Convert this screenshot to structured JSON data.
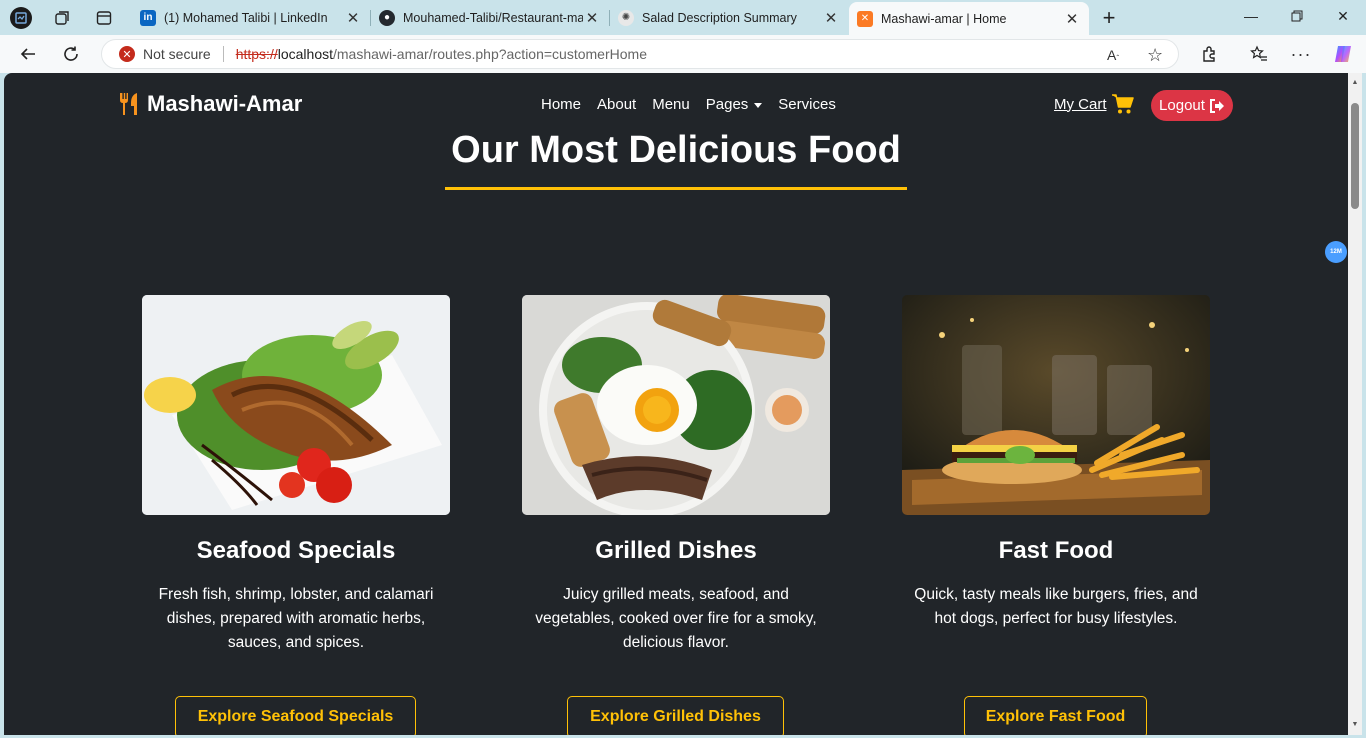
{
  "browser": {
    "tabs": [
      {
        "title": "(1) Mohamed Talibi | LinkedIn",
        "favicon": "linkedin-icon",
        "color": "#0a66c2",
        "glyph": "in"
      },
      {
        "title": "Mouhamed-Talibi/Restaurant-ma",
        "favicon": "github-icon",
        "color": "#24292f",
        "glyph": "G"
      },
      {
        "title": "Salad Description Summary",
        "favicon": "chatgpt-icon",
        "color": "#6b6b6b",
        "glyph": "✺"
      },
      {
        "title": "Mashawi-amar | Home",
        "favicon": "xampp-icon",
        "color": "#fb7a24",
        "glyph": "✕"
      }
    ],
    "address": {
      "security_label": "Not secure",
      "protocol": "https://",
      "host": "localhost",
      "path": "/mashawi-amar/routes.php?action=customerHome"
    }
  },
  "site": {
    "brand": "Mashawi-Amar",
    "nav": {
      "home": "Home",
      "about": "About",
      "menu": "Menu",
      "pages": "Pages",
      "services": "Services"
    },
    "cart_label": "My Cart",
    "logout_label": "Logout",
    "section_title": "Our Most Delicious Food",
    "accent": "#ffc107",
    "cards": [
      {
        "title": "Seafood Specials",
        "text": "Fresh fish, shrimp, lobster, and calamari dishes, prepared with aromatic herbs, sauces, and spices.",
        "button": "Explore Seafood Specials"
      },
      {
        "title": "Grilled Dishes",
        "text": "Juicy grilled meats, seafood, and vegetables, cooked over fire for a smoky, delicious flavor.",
        "button": "Explore Grilled Dishes"
      },
      {
        "title": "Fast Food",
        "text": "Quick, tasty meals like burgers, fries, and hot dogs, perfect for busy lifestyles.",
        "button": "Explore Fast Food"
      }
    ],
    "extension_badge": "12M"
  }
}
